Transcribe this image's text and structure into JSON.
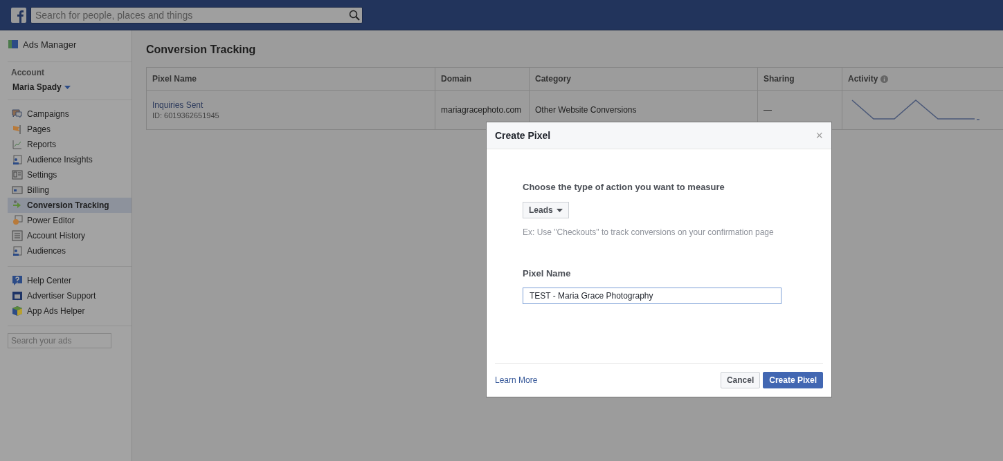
{
  "top_bar": {
    "search": {
      "placeholder": "Search for people, places and things"
    }
  },
  "sidebar": {
    "title": "Ads Manager",
    "account": {
      "label": "Account",
      "name": "Maria Spady"
    },
    "nav_items": [
      {
        "label": "Campaigns",
        "selected": false
      },
      {
        "label": "Pages",
        "selected": false
      },
      {
        "label": "Reports",
        "selected": false
      },
      {
        "label": "Audience Insights",
        "selected": false
      },
      {
        "label": "Settings",
        "selected": false
      },
      {
        "label": "Billing",
        "selected": false
      },
      {
        "label": "Conversion Tracking",
        "selected": true
      },
      {
        "label": "Power Editor",
        "selected": false
      },
      {
        "label": "Account History",
        "selected": false
      },
      {
        "label": "Audiences",
        "selected": false
      }
    ],
    "help_items": [
      {
        "label": "Help Center"
      },
      {
        "label": "Advertiser Support"
      },
      {
        "label": "App Ads Helper"
      }
    ],
    "search": {
      "placeholder": "Search your ads"
    }
  },
  "main": {
    "title": "Conversion Tracking",
    "table": {
      "columns": [
        "Pixel Name",
        "Domain",
        "Category",
        "Sharing",
        "Activity"
      ],
      "rows": [
        {
          "name": "Inquiries Sent",
          "id": "ID: 6019362651945",
          "domain": "mariagracephoto.com",
          "category": "Other Website Conversions",
          "sharing": "—"
        }
      ]
    }
  },
  "dialog": {
    "title": "Create Pixel",
    "close": "×",
    "action_label": "Choose the type of action you want to measure",
    "action_select": "Leads",
    "hint": "Ex: Use \"Checkouts\" to track conversions on your confirmation page",
    "name_label": "Pixel Name",
    "name_value": "TEST - Maria Grace Photography",
    "learn_more": "Learn More",
    "buttons": [
      {
        "label": "Cancel",
        "kind": "secondary"
      },
      {
        "label": "Create Pixel",
        "kind": "primary"
      }
    ]
  }
}
